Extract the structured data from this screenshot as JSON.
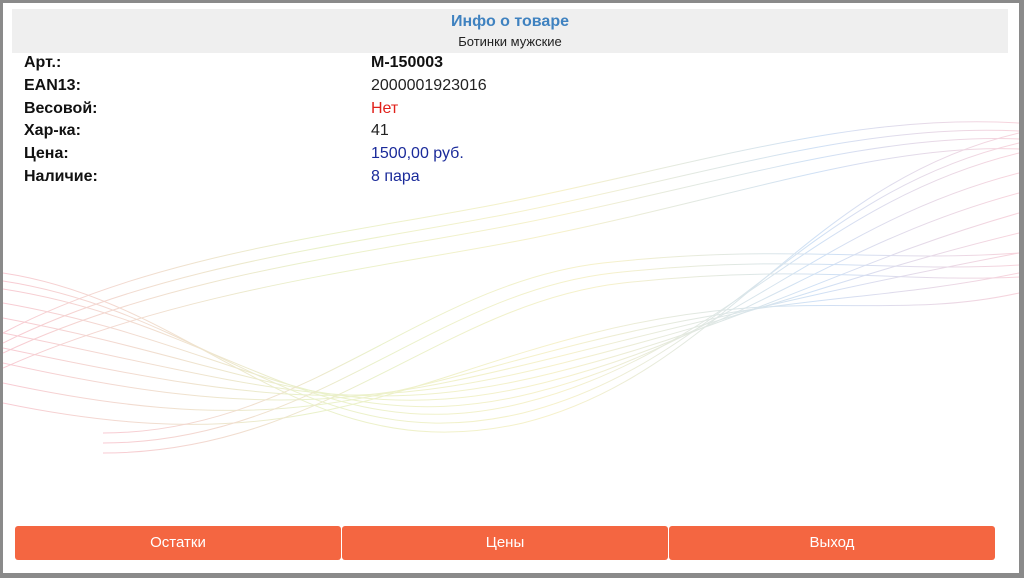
{
  "header": {
    "title": "Инфо о товаре",
    "subtitle": "Ботинки мужские"
  },
  "fields": [
    {
      "label": "Арт.:",
      "value": "М-150003"
    },
    {
      "label": "EAN13:",
      "value": "2000001923016"
    },
    {
      "label": "Весовой:",
      "value": "Нет"
    },
    {
      "label": "Хар-ка:",
      "value": "41"
    },
    {
      "label": "Цена:",
      "value": "1500,00 руб."
    },
    {
      "label": "Наличие:",
      "value": "8 пара"
    }
  ],
  "buttons": {
    "stock": "Остатки",
    "prices": "Цены",
    "exit": "Выход"
  },
  "colors": {
    "header_title": "#3f82c0",
    "button": "#f46641",
    "value_red": "#e0201a",
    "value_blue": "#1a2a9a"
  }
}
